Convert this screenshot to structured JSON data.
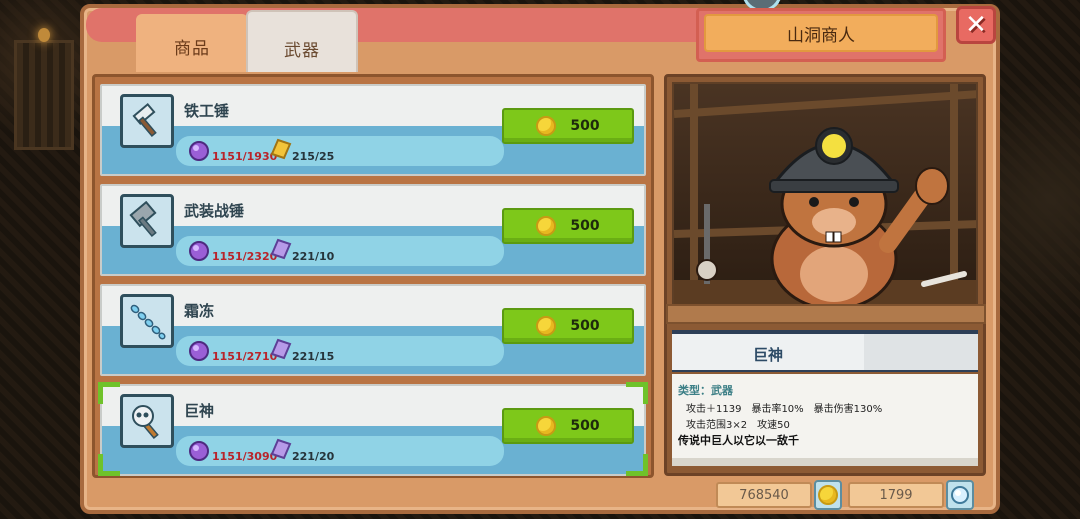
{
  "tabs": [
    {
      "label": "商品",
      "active": false
    },
    {
      "label": "武器",
      "active": true
    }
  ],
  "merchant": {
    "name": "山洞商人"
  },
  "close_icon": "close-x-icon",
  "items": [
    {
      "name": "铁工锤",
      "icon": "hammer-icon",
      "stat_a": "1151/1930",
      "stat_b_icon": "gold-gem-icon",
      "stat_b": "215/25",
      "price": "500"
    },
    {
      "name": "武装战锤",
      "icon": "war-hammer-icon",
      "stat_a": "1151/2320",
      "stat_b_icon": "purple-crystal-icon",
      "stat_b": "221/10",
      "price": "500"
    },
    {
      "name": "霜冻",
      "icon": "frost-staff-icon",
      "stat_a": "1151/2710",
      "stat_b_icon": "purple-crystal-icon",
      "stat_b": "221/15",
      "price": "500"
    },
    {
      "name": "巨神",
      "icon": "skull-hammer-icon",
      "stat_a": "1151/3090",
      "stat_b_icon": "purple-crystal-icon",
      "stat_b": "221/20",
      "price": "500",
      "selected": true
    }
  ],
  "detail": {
    "name": "巨神",
    "type_line": "类型：武器",
    "stats_line1": "攻击＋1139　暴击率10%　暴击伤害130%",
    "stats_line2": "攻击范围3×2　攻速50",
    "flavor": "传说中巨人以它以一敌千"
  },
  "currency": {
    "gold": "768540",
    "gems": "1799"
  },
  "colors": {
    "buy_button": "#7ec81a",
    "frame": "#d99a67",
    "selection": "#6fc22a"
  }
}
